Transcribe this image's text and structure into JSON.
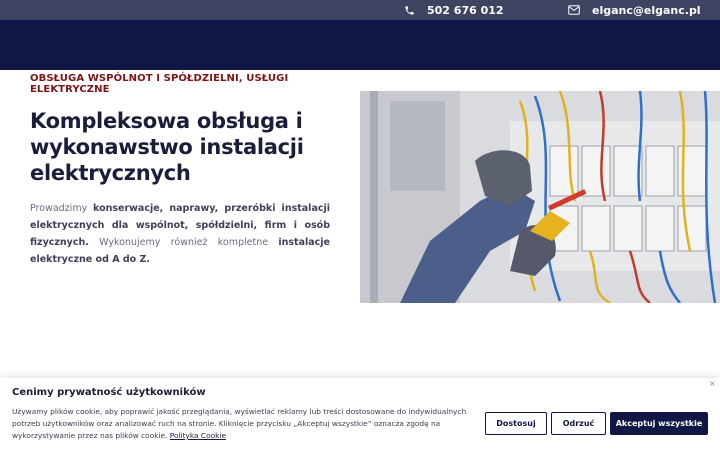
{
  "topbar": {
    "phone": "502 676 012",
    "email": "elganc@elganc.pl",
    "phone_icon": "phone-icon",
    "email_icon": "envelope-icon"
  },
  "hero": {
    "eyebrow": "Obsługa wspólnot i spółdzielni, usługi elektryczne",
    "headline": "Kompleksowa obsługa i wykonawstwo instalacji elektrycznych",
    "desc_1": "Prowadzimy ",
    "desc_2": "konserwacje, naprawy, przeróbki instalacji elektrycznych dla wspólnot, spółdzielni, firm i osób fizycznych.",
    "desc_3": " Wykonujemy również kompletne ",
    "desc_4": "instalacje elektryczne od A do Z."
  },
  "cookie": {
    "title": "Cenimy prywatność użytkowników",
    "text": "Używamy plików cookie, aby poprawić jakość przeglądania, wyświetlać reklamy lub treści dostosowane do indywidualnych potrzeb użytkowników oraz analizować ruch na stronie. Kliknięcie przycisku „Akceptuj wszystkie” oznacza zgodę na wykorzystywanie przez nas plików cookie. ",
    "link": "Polityka Cookie",
    "close": "×",
    "customize": "Dostosuj",
    "reject": "Odrzuć",
    "accept": "Akceptuj wszystkie"
  },
  "colors": {
    "navy": "#101744",
    "topbar": "#3f4362",
    "accent_red": "#7a1416"
  }
}
